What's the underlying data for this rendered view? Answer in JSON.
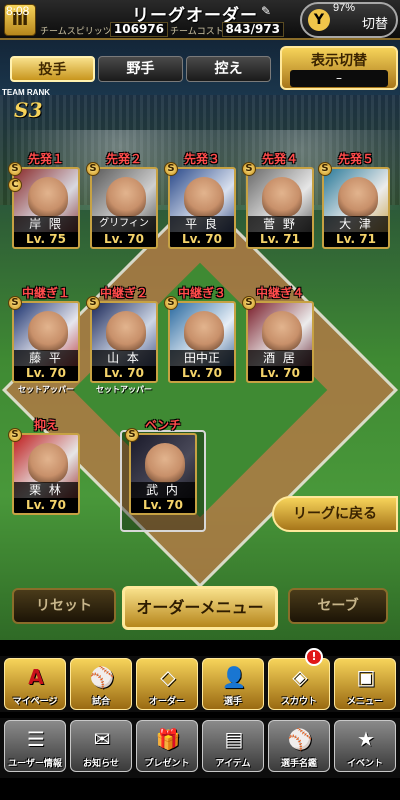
{
  "status_bar": {
    "time": "8:08",
    "battery": "97%"
  },
  "header": {
    "title": "リーグオーダー",
    "spirit_label": "チームスピリッツ",
    "spirit_value": "106976",
    "cost_label": "チームコスト",
    "cost_value": "843/973",
    "switch_label": "切替"
  },
  "tabs": [
    {
      "label": "投手",
      "active": true
    },
    {
      "label": "野手",
      "active": false
    },
    {
      "label": "控え",
      "active": false
    }
  ],
  "display_switch": {
    "title": "表示切替",
    "value": "–"
  },
  "team_rank": {
    "label": "TEAM RANK",
    "value": "S3"
  },
  "players": [
    {
      "slot": "先発１",
      "name": "岸 隈",
      "level": "Lv. 75",
      "badge": "S",
      "extra_badge": "C"
    },
    {
      "slot": "先発２",
      "name": "グリフィン",
      "level": "Lv. 70",
      "badge": "S"
    },
    {
      "slot": "先発３",
      "name": "平 良",
      "level": "Lv. 70",
      "badge": "S"
    },
    {
      "slot": "先発４",
      "name": "菅 野",
      "level": "Lv. 71",
      "badge": "S"
    },
    {
      "slot": "先発５",
      "name": "大 津",
      "level": "Lv. 71",
      "badge": "S"
    },
    {
      "slot": "中継ぎ１",
      "name": "藤 平",
      "level": "Lv. 70",
      "badge": "S",
      "role": "セットアッパー"
    },
    {
      "slot": "中継ぎ２",
      "name": "山 本",
      "level": "Lv. 70",
      "badge": "S",
      "role": "セットアッパー"
    },
    {
      "slot": "中継ぎ３",
      "name": "田中正",
      "level": "Lv. 70",
      "badge": "S"
    },
    {
      "slot": "中継ぎ４",
      "name": "酒 居",
      "level": "Lv. 70",
      "badge": "S"
    },
    {
      "slot": "抑え",
      "name": "栗 林",
      "level": "Lv. 70",
      "badge": "S"
    },
    {
      "slot": "ベンチ",
      "name": "武 内",
      "level": "Lv. 70",
      "badge": "S"
    }
  ],
  "back_button": "リーグに戻る",
  "actions": {
    "reset": "リセット",
    "order_menu": "オーダーメニュー",
    "save": "セーブ"
  },
  "nav_primary": [
    {
      "label": "マイページ",
      "icon": "A"
    },
    {
      "label": "試合",
      "icon": "⚾"
    },
    {
      "label": "オーダー",
      "icon": "◇"
    },
    {
      "label": "選手",
      "icon": "👤"
    },
    {
      "label": "スカウト",
      "icon": "◈"
    },
    {
      "label": "メニュー",
      "icon": "▣"
    }
  ],
  "scout_notification": "!",
  "nav_secondary": [
    {
      "label": "ユーザー情報",
      "icon": "☰"
    },
    {
      "label": "お知らせ",
      "icon": "✉"
    },
    {
      "label": "プレゼント",
      "icon": "🎁"
    },
    {
      "label": "アイテム",
      "icon": "▤"
    },
    {
      "label": "選手名鑑",
      "icon": "⚾"
    },
    {
      "label": "イベント",
      "icon": "★"
    }
  ]
}
